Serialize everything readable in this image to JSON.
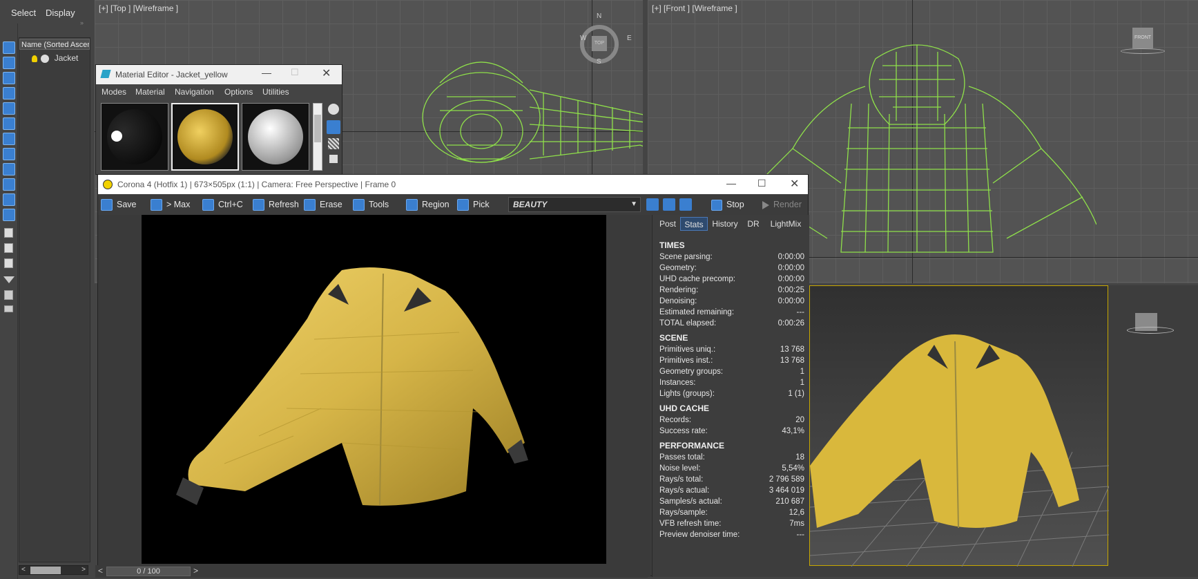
{
  "top_tabs": {
    "select": "Select",
    "display": "Display"
  },
  "explorer": {
    "header": "Name (Sorted Ascending)",
    "items": [
      {
        "label": "Jacket"
      }
    ]
  },
  "viewports": {
    "top_label": "[+] [Top ] [Wireframe ]",
    "front_label": "[+] [Front ] [Wireframe ]",
    "viewcube_top": {
      "n": "N",
      "s": "S",
      "e": "E",
      "w": "W",
      "face": "TOP"
    },
    "viewcube_front": "FRONT"
  },
  "material_editor": {
    "title": "Material Editor - Jacket_yellow",
    "menu": [
      "Modes",
      "Material",
      "Navigation",
      "Options",
      "Utilities"
    ]
  },
  "vfb": {
    "title": "Corona 4 (Hotfix 1) | 673×505px (1:1) | Camera: Free Perspective | Frame 0",
    "toolbar": {
      "save": "Save",
      "to_max": "> Max",
      "copy": "Ctrl+C",
      "refresh": "Refresh",
      "erase": "Erase",
      "tools": "Tools",
      "region": "Region",
      "pick": "Pick",
      "pass": "BEAUTY",
      "stop": "Stop",
      "render": "Render"
    },
    "tabs": [
      "Post",
      "Stats",
      "History",
      "DR",
      "LightMix"
    ],
    "active_tab": "Stats",
    "footer": "0 / 100",
    "stats": {
      "times_title": "TIMES",
      "times": [
        {
          "k": "Scene parsing:",
          "v": "0:00:00"
        },
        {
          "k": "Geometry:",
          "v": "0:00:00"
        },
        {
          "k": "UHD cache precomp:",
          "v": "0:00:00"
        },
        {
          "k": "Rendering:",
          "v": "0:00:25"
        },
        {
          "k": "Denoising:",
          "v": "0:00:00"
        },
        {
          "k": "Estimated remaining:",
          "v": "---"
        },
        {
          "k": "TOTAL elapsed:",
          "v": "0:00:26"
        }
      ],
      "scene_title": "SCENE",
      "scene": [
        {
          "k": "Primitives uniq.:",
          "v": "13 768"
        },
        {
          "k": "Primitives inst.:",
          "v": "13 768"
        },
        {
          "k": "Geometry groups:",
          "v": "1"
        },
        {
          "k": "Instances:",
          "v": "1"
        },
        {
          "k": "Lights (groups):",
          "v": "1 (1)"
        }
      ],
      "uhd_title": "UHD CACHE",
      "uhd": [
        {
          "k": "Records:",
          "v": "20"
        },
        {
          "k": "Success rate:",
          "v": "43,1%"
        }
      ],
      "perf_title": "PERFORMANCE",
      "perf": [
        {
          "k": "Passes total:",
          "v": "18"
        },
        {
          "k": "Noise level:",
          "v": "5,54%"
        },
        {
          "k": "Rays/s total:",
          "v": "2 796 589"
        },
        {
          "k": "Rays/s actual:",
          "v": "3 464 019"
        },
        {
          "k": "Samples/s actual:",
          "v": "210 687"
        },
        {
          "k": "Rays/sample:",
          "v": "12,6"
        },
        {
          "k": "VFB refresh time:",
          "v": "7ms"
        },
        {
          "k": "Preview denoiser time:",
          "v": "---"
        }
      ]
    }
  },
  "colors": {
    "wireframe": "#8fe04a",
    "jacket": "#d9b83c",
    "accent": "#3a7fd0",
    "viewport_active": "#c8a800"
  }
}
